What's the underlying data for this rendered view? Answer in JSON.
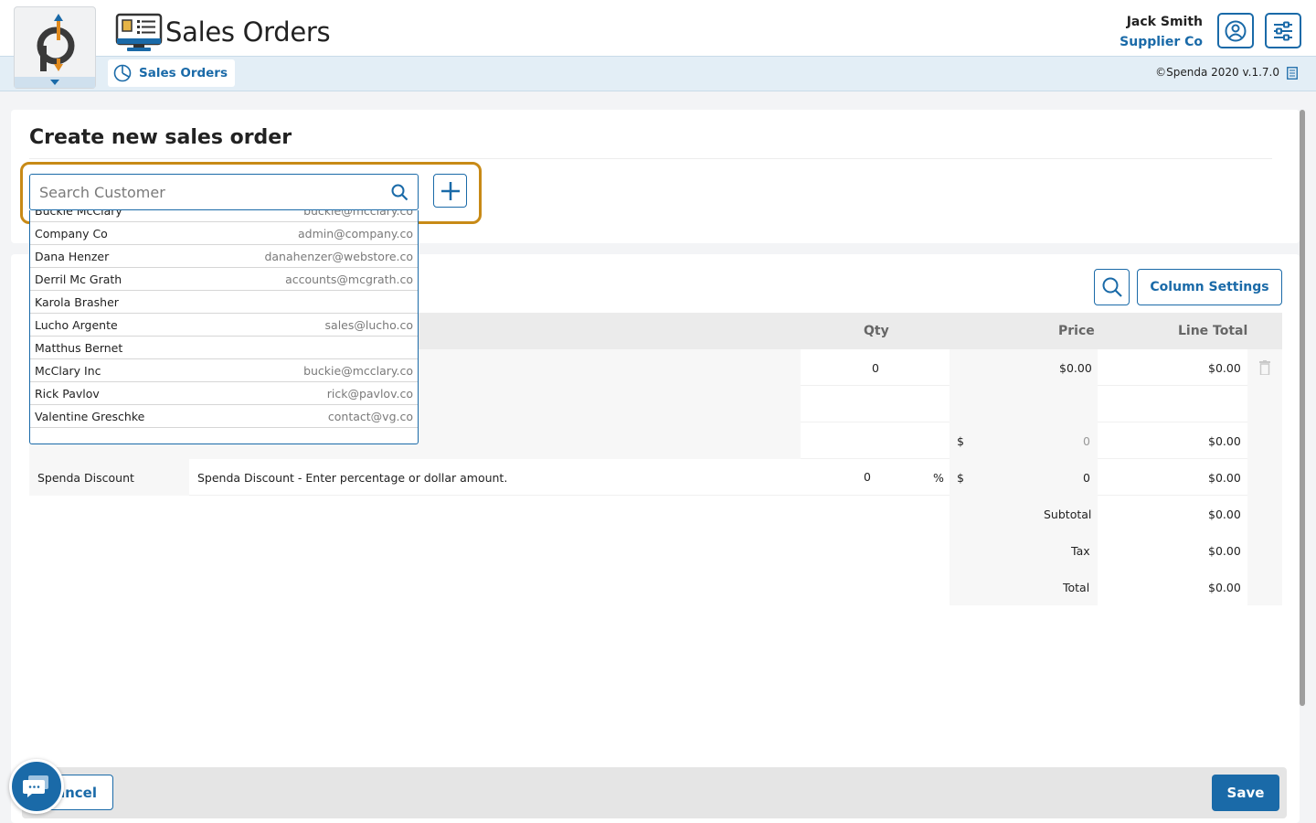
{
  "header": {
    "app_title": "Sales Orders",
    "user_name": "Jack Smith",
    "user_company": "Supplier Co",
    "profile_icon": "user-circle-icon",
    "settings_icon": "sliders-icon"
  },
  "nav": {
    "tab_label": "Sales Orders",
    "tab_icon": "pie-chart-icon",
    "version": "©Spenda 2020 v.1.7.0",
    "version_icon": "document-icon"
  },
  "form": {
    "title": "Create new sales order",
    "search_placeholder": "Search Customer"
  },
  "customers": [
    {
      "name": "Buckie McClary",
      "email": "buckie@mcclary.co"
    },
    {
      "name": "Company Co",
      "email": "admin@company.co"
    },
    {
      "name": "Dana Henzer",
      "email": "danahenzer@webstore.co"
    },
    {
      "name": "Derril Mc Grath",
      "email": "accounts@mcgrath.co"
    },
    {
      "name": "Karola Brasher",
      "email": ""
    },
    {
      "name": "Lucho Argente",
      "email": "sales@lucho.co"
    },
    {
      "name": "Matthus Bernet",
      "email": ""
    },
    {
      "name": "McClary Inc",
      "email": "buckie@mcclary.co"
    },
    {
      "name": "Rick Pavlov",
      "email": "rick@pavlov.co"
    },
    {
      "name": "Valentine Greschke",
      "email": "contact@vg.co"
    }
  ],
  "toolbar": {
    "column_settings_label": "Column Settings"
  },
  "table": {
    "headers": {
      "qty": "Qty",
      "price": "Price",
      "line_total": "Line Total"
    },
    "line_item": {
      "qty": "0",
      "price": "$0.00",
      "line_total": "$0.00"
    },
    "shipping": {
      "currency": "$",
      "price": "0",
      "line_total": "$0.00"
    },
    "discount": {
      "code": "Spenda Discount",
      "description": "Spenda Discount - Enter percentage or dollar amount.",
      "percent": "0",
      "percent_sign": "%",
      "currency": "$",
      "amount": "0",
      "line_total": "$0.00"
    },
    "subtotal_label": "Subtotal",
    "subtotal": "$0.00",
    "tax_label": "Tax",
    "tax": "$0.00",
    "total_label": "Total",
    "total": "$0.00"
  },
  "footer": {
    "cancel_label": "Cancel",
    "save_label": "Save"
  },
  "colors": {
    "accent": "#1a6aa8",
    "highlight": "#c88a16"
  }
}
